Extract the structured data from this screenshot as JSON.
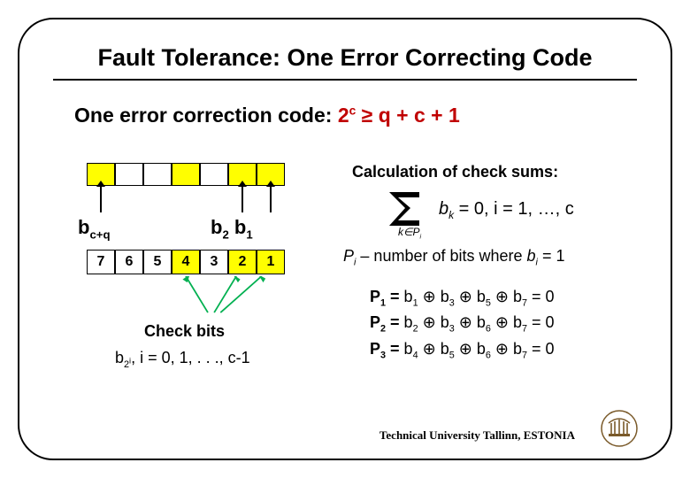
{
  "title": "Fault Tolerance:  One Error Correcting Code",
  "subtitle_prefix": "One error correction code:  ",
  "subtitle_formula_base": "2",
  "subtitle_formula_exp": "c",
  "subtitle_formula_rest": " ≥ q + c + 1",
  "left": {
    "label_bcq_base": "b",
    "label_bcq_sub": "c+q",
    "label_b2_base": "b",
    "label_b2_sub": "2",
    "label_b1_base": "b",
    "label_b1_sub": "1",
    "cells": [
      "7",
      "6",
      "5",
      "4",
      "3",
      "2",
      "1"
    ],
    "check_bits_label": "Check bits",
    "pow_label_base": "b",
    "pow_label_sub": "2",
    "pow_label_sup": "i",
    "pow_label_rest": ", i = 0, 1, . . ., c-1"
  },
  "right": {
    "calc_heading": "Calculation of check sums:",
    "sigma_sub_k": "k∈P",
    "sigma_sub_i": "i",
    "sigma_body_bk": "b",
    "sigma_body_k": "k",
    "sigma_eq": " = 0, i = 1, …, c",
    "pi_note_P": "P",
    "pi_note_i": "i",
    "pi_note_rest": " – number of bits where ",
    "pi_note_b": "b",
    "pi_note_bi": "i",
    "pi_note_tail": " = 1",
    "p_eqs": [
      {
        "lhs_P": "P",
        "lhs_i": "1",
        "terms": [
          "1",
          "3",
          "5",
          "7"
        ]
      },
      {
        "lhs_P": "P",
        "lhs_i": "2",
        "terms": [
          "2",
          "3",
          "6",
          "7"
        ]
      },
      {
        "lhs_P": "P",
        "lhs_i": "3",
        "terms": [
          "4",
          "5",
          "6",
          "7"
        ]
      }
    ]
  },
  "footer": "Technical University Tallinn, ESTONIA"
}
